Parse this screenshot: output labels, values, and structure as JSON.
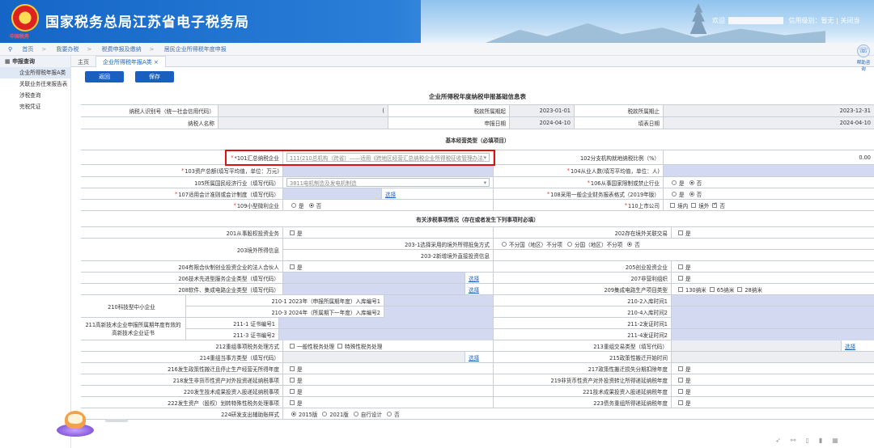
{
  "header": {
    "site_title": "国家税务总局江苏省电子税务局",
    "logo_caption": "中国税务",
    "welcome": "欢迎",
    "credit_level": "信用级别：暂无",
    "close": "关闭当"
  },
  "breadcrumb": [
    "首页",
    "我要办税",
    "税费申报及缴纳",
    "居民企业所得税年度申报"
  ],
  "sidebar": {
    "head": "申报查询",
    "items": [
      "企业所得税年报A类",
      "关联业务往来报告表",
      "涉税查询",
      "完税凭证"
    ]
  },
  "tabs": [
    "主页",
    "企业所得税年报A类 ×"
  ],
  "help_label": "帮助咨询",
  "buttons": {
    "back": "返回",
    "save": "保存"
  },
  "form": {
    "title": "企业所得税年度纳税申报基础信息表",
    "taxpayer_id_label": "纳税人识别号（统一社会信用代码）",
    "taxpayer_id_val": "(",
    "period_start_label": "税款所属期起",
    "period_start": "2023-01-01",
    "period_end_label": "税款所属期止",
    "period_end": "2023-12-31",
    "taxpayer_name_label": "纳税人名称",
    "apply_date_label": "申报日期",
    "apply_date": "2024-04-10",
    "fill_date_label": "填表日期",
    "fill_date": "2024-04-10",
    "sec_basic": "基本经营类型（必填项目）",
    "f101": "*101汇总纳税企业",
    "f101_val": "111(210总机构（跨省）——适用《跨地区经营汇总纳税企业所得税征收管理办法》",
    "f102": "102分支机构就地纳税比例（%）",
    "f102_val": "0.00",
    "f103": "*103资产总额(填写平均值，单位：万元)",
    "f104": "*104从业人数(填写平均值，单位：人)",
    "f105": "105所属国民经济行业（填写代码）",
    "f105_val": "3811电机制造及发电机制造",
    "f106": "*106从事国家限制或禁止行业",
    "yes": "是",
    "no": "否",
    "f107": "*107适用会计准则或会计制度（填写代码）",
    "choose": "选择",
    "f108": "*108采用一般企业财务报表格式（2019年版）",
    "f109": "*109小型微利企业",
    "f110": "*110上市公司",
    "f110_opts": [
      "境内",
      "境外",
      "否"
    ],
    "sec_tax": "有关涉税事项情况（存在或者发生下列事项时必填）",
    "f201": "201从事股权投资业务",
    "f202": "202存在境外关联交易",
    "f203": "203境外所得信息",
    "f203_1": "203-1选择采用的境外所得抵免方式",
    "f203_1_opts": [
      "不分国（地区）不分项",
      "分国（地区）不分项",
      "否"
    ],
    "f203_2": "203-2新增境外直接投资信息",
    "f204": "204有限合伙制创业投资企业的法人合伙人",
    "f205": "205创业投资企业",
    "f206": "206技术先进型服务企业类型（填写代码）",
    "f207": "207非营利组织",
    "f208": "208软件、集成电路企业类型（填写代码）",
    "f209": "209集成电路生产项目类型",
    "f209_opts": [
      "130纳米",
      "65纳米",
      "28纳米"
    ],
    "f210": "210科技型中小企业",
    "f210_1": "210-1 2023年（申报所属期年度）入库编号1",
    "f210_2": "210-2入库时间1",
    "f210_3": "210-3 2024年（所属期下一年度）入库编号2",
    "f210_4": "210-4入库时间2",
    "f211": "211高新技术企业申报所属期年度有效的高新技术企业证书",
    "f211_1": "211-1 证书编号1",
    "f211_2": "211-2发证时间1",
    "f211_3": "211-3 证书编号2",
    "f211_4": "211-4发证时间2",
    "f212": "212重组事项税务处理方式",
    "f212_opts": [
      "一般性税务处理",
      "特殊性税务处理"
    ],
    "f213": "213重组交易类型（填写代码）",
    "f214": "214重组当事方类型（填写代码）",
    "f215": "215政策性搬迁开始时间",
    "f216": "216发生政策性搬迁且停止生产经营无所得年度",
    "f217": "217政策性搬迁损失分期扣除年度",
    "f218": "218发生非货币性资产对外投资递延纳税事项",
    "f219": "219非货币性资产对外投资转让所得递延纳税年度",
    "f220": "220发生技术成果投资入股递延纳税事项",
    "f221": "221技术成果投资入股递延纳税年度",
    "f222": "222发生资产（股权）划转特殊性税务处理事项",
    "f223": "223债务重组所得递延纳税年度",
    "f224": "224研发支出辅助账样式",
    "f224_opts": [
      "2015版",
      "2021版",
      "自行设计",
      "否"
    ]
  }
}
